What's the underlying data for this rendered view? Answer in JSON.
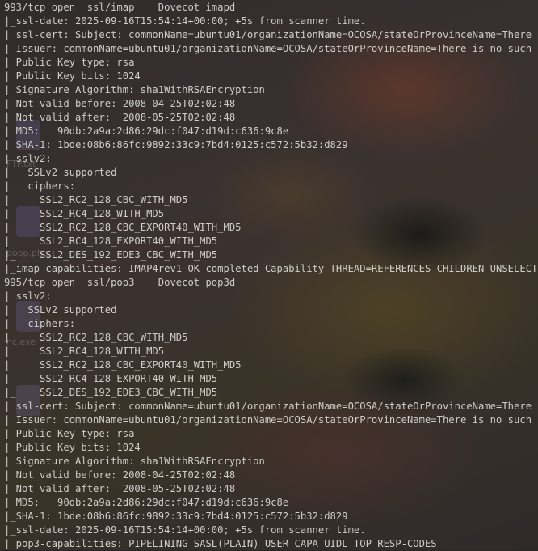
{
  "terminal": {
    "lines": [
      "993/tcp open  ssl/imap    Dovecot imapd",
      "|_ssl-date: 2025-09-16T15:54:14+00:00; +5s from scanner time.",
      "| ssl-cert: Subject: commonName=ubuntu01/organizationName=OCOSA/stateOrProvinceName=There is no such thing outside US/countryName=XX",
      "| Issuer: commonName=ubuntu01/organizationName=OCOSA/stateOrProvinceName=There is no such thing outside US/countryName=XX",
      "| Public Key type: rsa",
      "| Public Key bits: 1024",
      "| Signature Algorithm: sha1WithRSAEncryption",
      "| Not valid before: 2008-04-25T02:02:48",
      "| Not valid after:  2008-05-25T02:02:48",
      "| MD5:   90db:2a9a:2d86:29dc:f047:d19d:c636:9c8e",
      "|_SHA-1: 1bde:08b6:86fc:9892:33c9:7bd4:0125:c572:5b32:d829",
      "| sslv2:",
      "|   SSLv2 supported",
      "|   ciphers:",
      "|     SSL2_RC2_128_CBC_WITH_MD5",
      "|     SSL2_RC4_128_WITH_MD5",
      "|     SSL2_RC2_128_CBC_EXPORT40_WITH_MD5",
      "|     SSL2_RC4_128_EXPORT40_WITH_MD5",
      "|_    SSL2_DES_192_EDE3_CBC_WITH_MD5",
      "|_imap-capabilities: IMAP4rev1 OK completed Capability THREAD=REFERENCES CHILDREN UNSELECT",
      "995/tcp open  ssl/pop3    Dovecot pop3d",
      "| sslv2:",
      "|   SSLv2 supported",
      "|   ciphers:",
      "|     SSL2_RC2_128_CBC_WITH_MD5",
      "|     SSL2_RC4_128_WITH_MD5",
      "|     SSL2_RC2_128_CBC_EXPORT40_WITH_MD5",
      "|     SSL2_RC4_128_EXPORT40_WITH_MD5",
      "|_    SSL2_DES_192_EDE3_CBC_WITH_MD5",
      "| ssl-cert: Subject: commonName=ubuntu01/organizationName=OCOSA/stateOrProvinceName=There is no such thing outside US/countryName=XX",
      "| Issuer: commonName=ubuntu01/organizationName=OCOSA/stateOrProvinceName=There is no such thing outside US/countryName=XX",
      "| Public Key type: rsa",
      "| Public Key bits: 1024",
      "| Signature Algorithm: sha1WithRSAEncryption",
      "| Not valid before: 2008-04-25T02:02:48",
      "| Not valid after:  2008-05-25T02:02:48",
      "| MD5:   90db:2a9a:2d86:29dc:f047:d19d:c636:9c8e",
      "|_SHA-1: 1bde:08b6:86fc:9892:33c9:7bd4:0125:c572:5b32:d829",
      "|_ssl-date: 2025-09-16T15:54:14+00:00; +5s from scanner time.",
      "|_pop3-capabilities: PIPELINING SASL(PLAIN) USER CAPA UIDL TOP RESP-CODES"
    ]
  },
  "desktop": {
    "labels": [
      "FTP.txt",
      "poop.php",
      "nc.exe"
    ]
  }
}
